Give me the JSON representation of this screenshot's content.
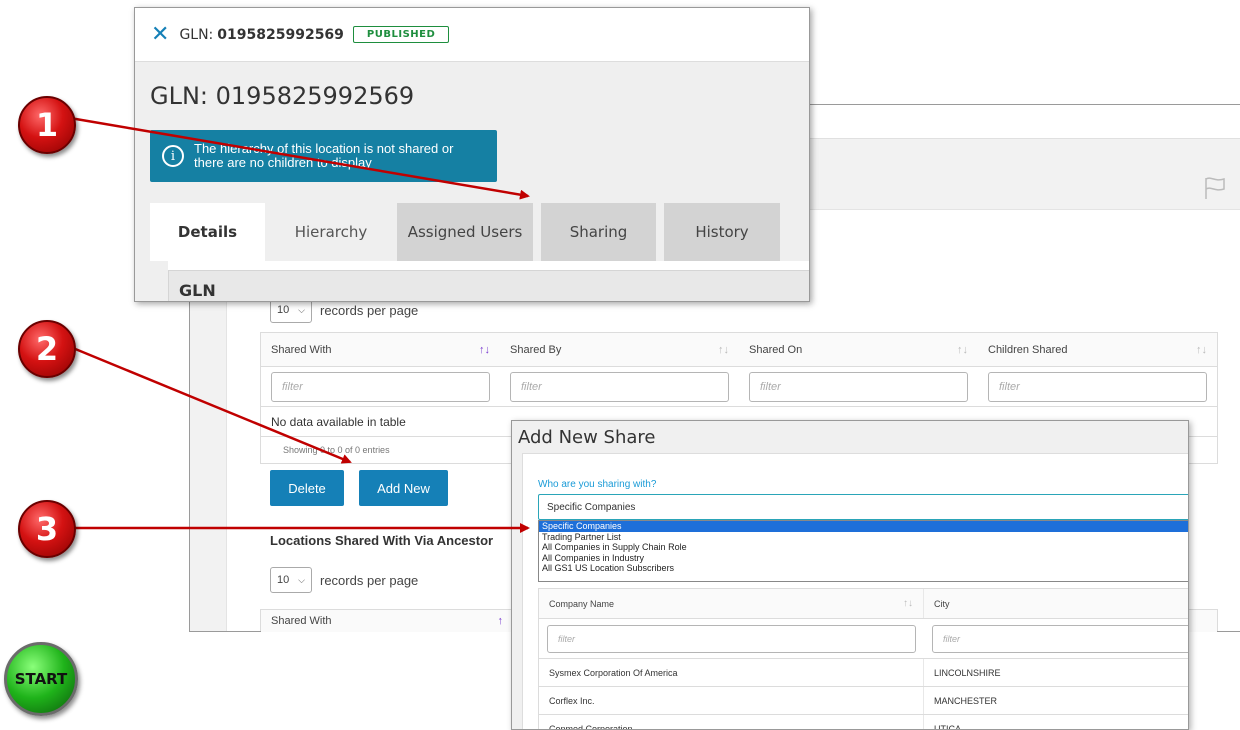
{
  "gln_panel": {
    "header_label": "GLN:",
    "header_number": "0195825992569",
    "status_badge": "PUBLISHED",
    "title": "GLN: 0195825992569",
    "alert_line1": "The hierarchy of this location is not shared or",
    "alert_line2": "there are no children to display",
    "tabs": [
      {
        "label": "Details"
      },
      {
        "label": "Hierarchy"
      },
      {
        "label": "Assigned Users"
      },
      {
        "label": "Sharing"
      },
      {
        "label": "History"
      }
    ],
    "section_title": "GLN"
  },
  "sharing_panel": {
    "records_per_page_value": "10",
    "records_per_page_label": "records per page",
    "columns": [
      {
        "label": "Shared With"
      },
      {
        "label": "Shared By"
      },
      {
        "label": "Shared On"
      },
      {
        "label": "Children Shared"
      }
    ],
    "filter_placeholder": "filter",
    "empty_message": "No data available in table",
    "entries_info": "Showing 0 to 0 of 0 entries",
    "delete_button": "Delete",
    "add_new_button": "Add New",
    "ancestor_section_title": "Locations Shared With Via Ancestor",
    "ancestor_records_value": "10",
    "ancestor_records_label": "records per page",
    "ancestor_first_column": "Shared With"
  },
  "add_share_dialog": {
    "title": "Add New Share",
    "question": "Who are you sharing with?",
    "selected_value": "Specific Companies",
    "options": [
      "Specific Companies",
      "Trading Partner List",
      "All Companies in Supply Chain Role",
      "All Companies in Industry",
      "All GS1 US Location Subscribers"
    ],
    "company_columns": [
      "Company Name",
      "City"
    ],
    "filter_placeholder": "filter",
    "companies": [
      {
        "name": "Sysmex Corporation Of America",
        "city": "LINCOLNSHIRE"
      },
      {
        "name": "Corflex Inc.",
        "city": "MANCHESTER"
      },
      {
        "name": "Conmed Corporation",
        "city": "UTICA"
      }
    ]
  },
  "annotations": {
    "steps": [
      "1",
      "2",
      "3"
    ],
    "start_label": "START"
  },
  "colors": {
    "primary_blue": "#1580b7",
    "alert_teal": "#1580a3",
    "published_green": "#1e8e3e",
    "arrow_red": "#c00000",
    "selected_option": "#1e6fd9",
    "sort_active": "#7c3fd1"
  }
}
